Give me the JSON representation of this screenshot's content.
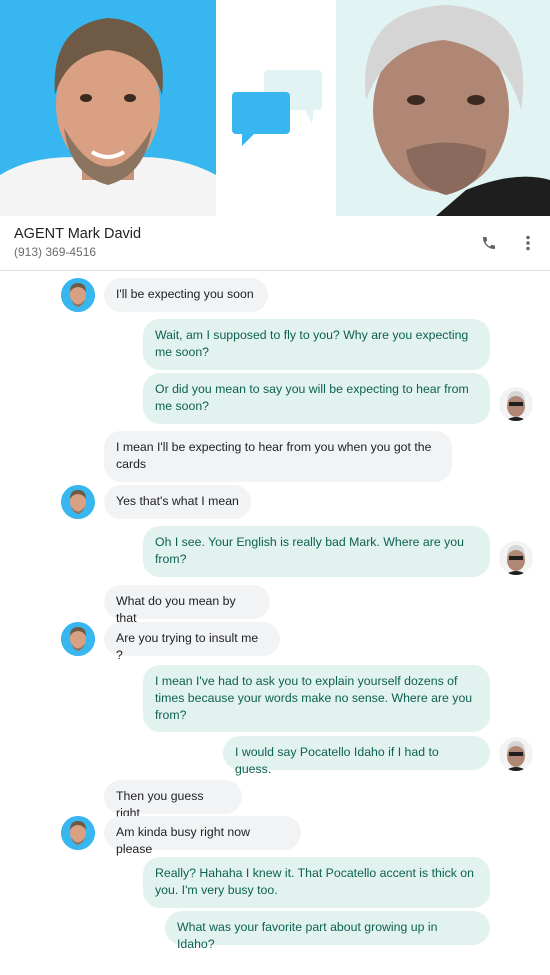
{
  "contact": {
    "name": "AGENT Mark David",
    "phone": "(913) 369-4516"
  },
  "icons": {
    "call": "phone-icon",
    "more": "more-vert-icon",
    "hero": "chat-bubbles-icon"
  },
  "colors": {
    "left_photo_bg": "#38b6f0",
    "right_photo_bg": "#e1f3f3",
    "incoming_bubble": "#f1f3f4",
    "outgoing_bubble": "#e2f2ef",
    "outgoing_text": "#0d6152",
    "icon_blue": "#38b6f0",
    "icon_teal": "#e1f3f3"
  },
  "messages": [
    {
      "dir": "in",
      "text": "I'll be expecting you soon"
    },
    {
      "dir": "out",
      "text": "Wait, am I supposed to fly to you? Why are you expecting me soon?"
    },
    {
      "dir": "out",
      "text": "Or did you mean to say you will be expecting to hear from me soon?"
    },
    {
      "dir": "in",
      "text": "I mean I'll be expecting to hear from you when you got the cards"
    },
    {
      "dir": "in",
      "text": "Yes that's what I mean"
    },
    {
      "dir": "out",
      "text": "Oh I see. Your English is really bad Mark. Where are you from?"
    },
    {
      "dir": "in",
      "text": "What do you mean by that"
    },
    {
      "dir": "in",
      "text": "Are you trying to insult me ?"
    },
    {
      "dir": "out",
      "text": "I mean I've had to ask you to explain yourself dozens of times because your words make no sense. Where are you from?"
    },
    {
      "dir": "out",
      "text": "I would say Pocatello Idaho if I had to guess."
    },
    {
      "dir": "in",
      "text": "Then you guess right"
    },
    {
      "dir": "in",
      "text": "Am kinda busy right now please"
    },
    {
      "dir": "out",
      "text": "Really? Hahaha I knew it. That Pocatello accent is thick on you. I'm very busy too."
    },
    {
      "dir": "out",
      "text": "What was your favorite part about growing up in Idaho?"
    }
  ]
}
